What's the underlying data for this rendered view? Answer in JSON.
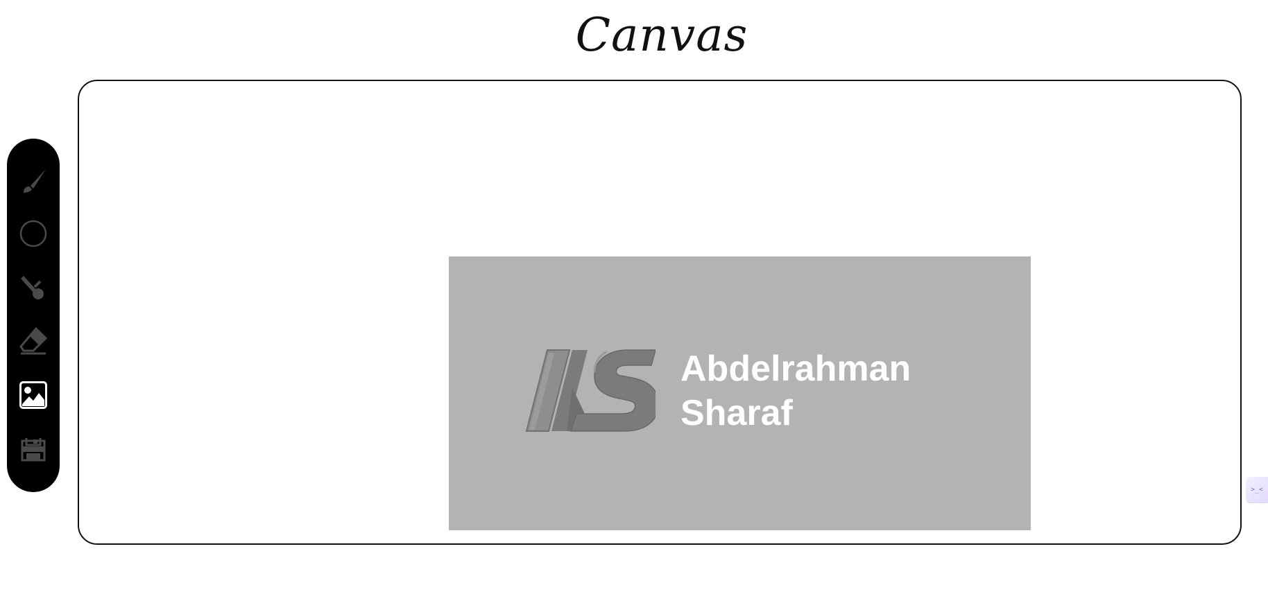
{
  "page": {
    "title": "Canvas"
  },
  "toolbar": {
    "tools": [
      {
        "name": "brush",
        "icon": "brush-icon",
        "active": false
      },
      {
        "name": "shape",
        "icon": "circle-icon",
        "active": false
      },
      {
        "name": "color-picker",
        "icon": "eyedropper-icon",
        "active": false
      },
      {
        "name": "eraser",
        "icon": "eraser-icon",
        "active": false
      },
      {
        "name": "image",
        "icon": "image-icon",
        "active": true
      },
      {
        "name": "save",
        "icon": "save-icon",
        "active": false
      }
    ]
  },
  "canvas": {
    "image": {
      "logo_letters": "AS",
      "text_line1": "Abdelrahman",
      "text_line2": "Sharaf"
    }
  },
  "side_widget": {
    "label": ">_<"
  },
  "colors": {
    "toolbar_bg": "#000000",
    "icon_inactive": "#4a4a4a",
    "icon_active": "#ffffff",
    "image_bg": "#b3b3b3",
    "logo_text": "#ffffff"
  }
}
